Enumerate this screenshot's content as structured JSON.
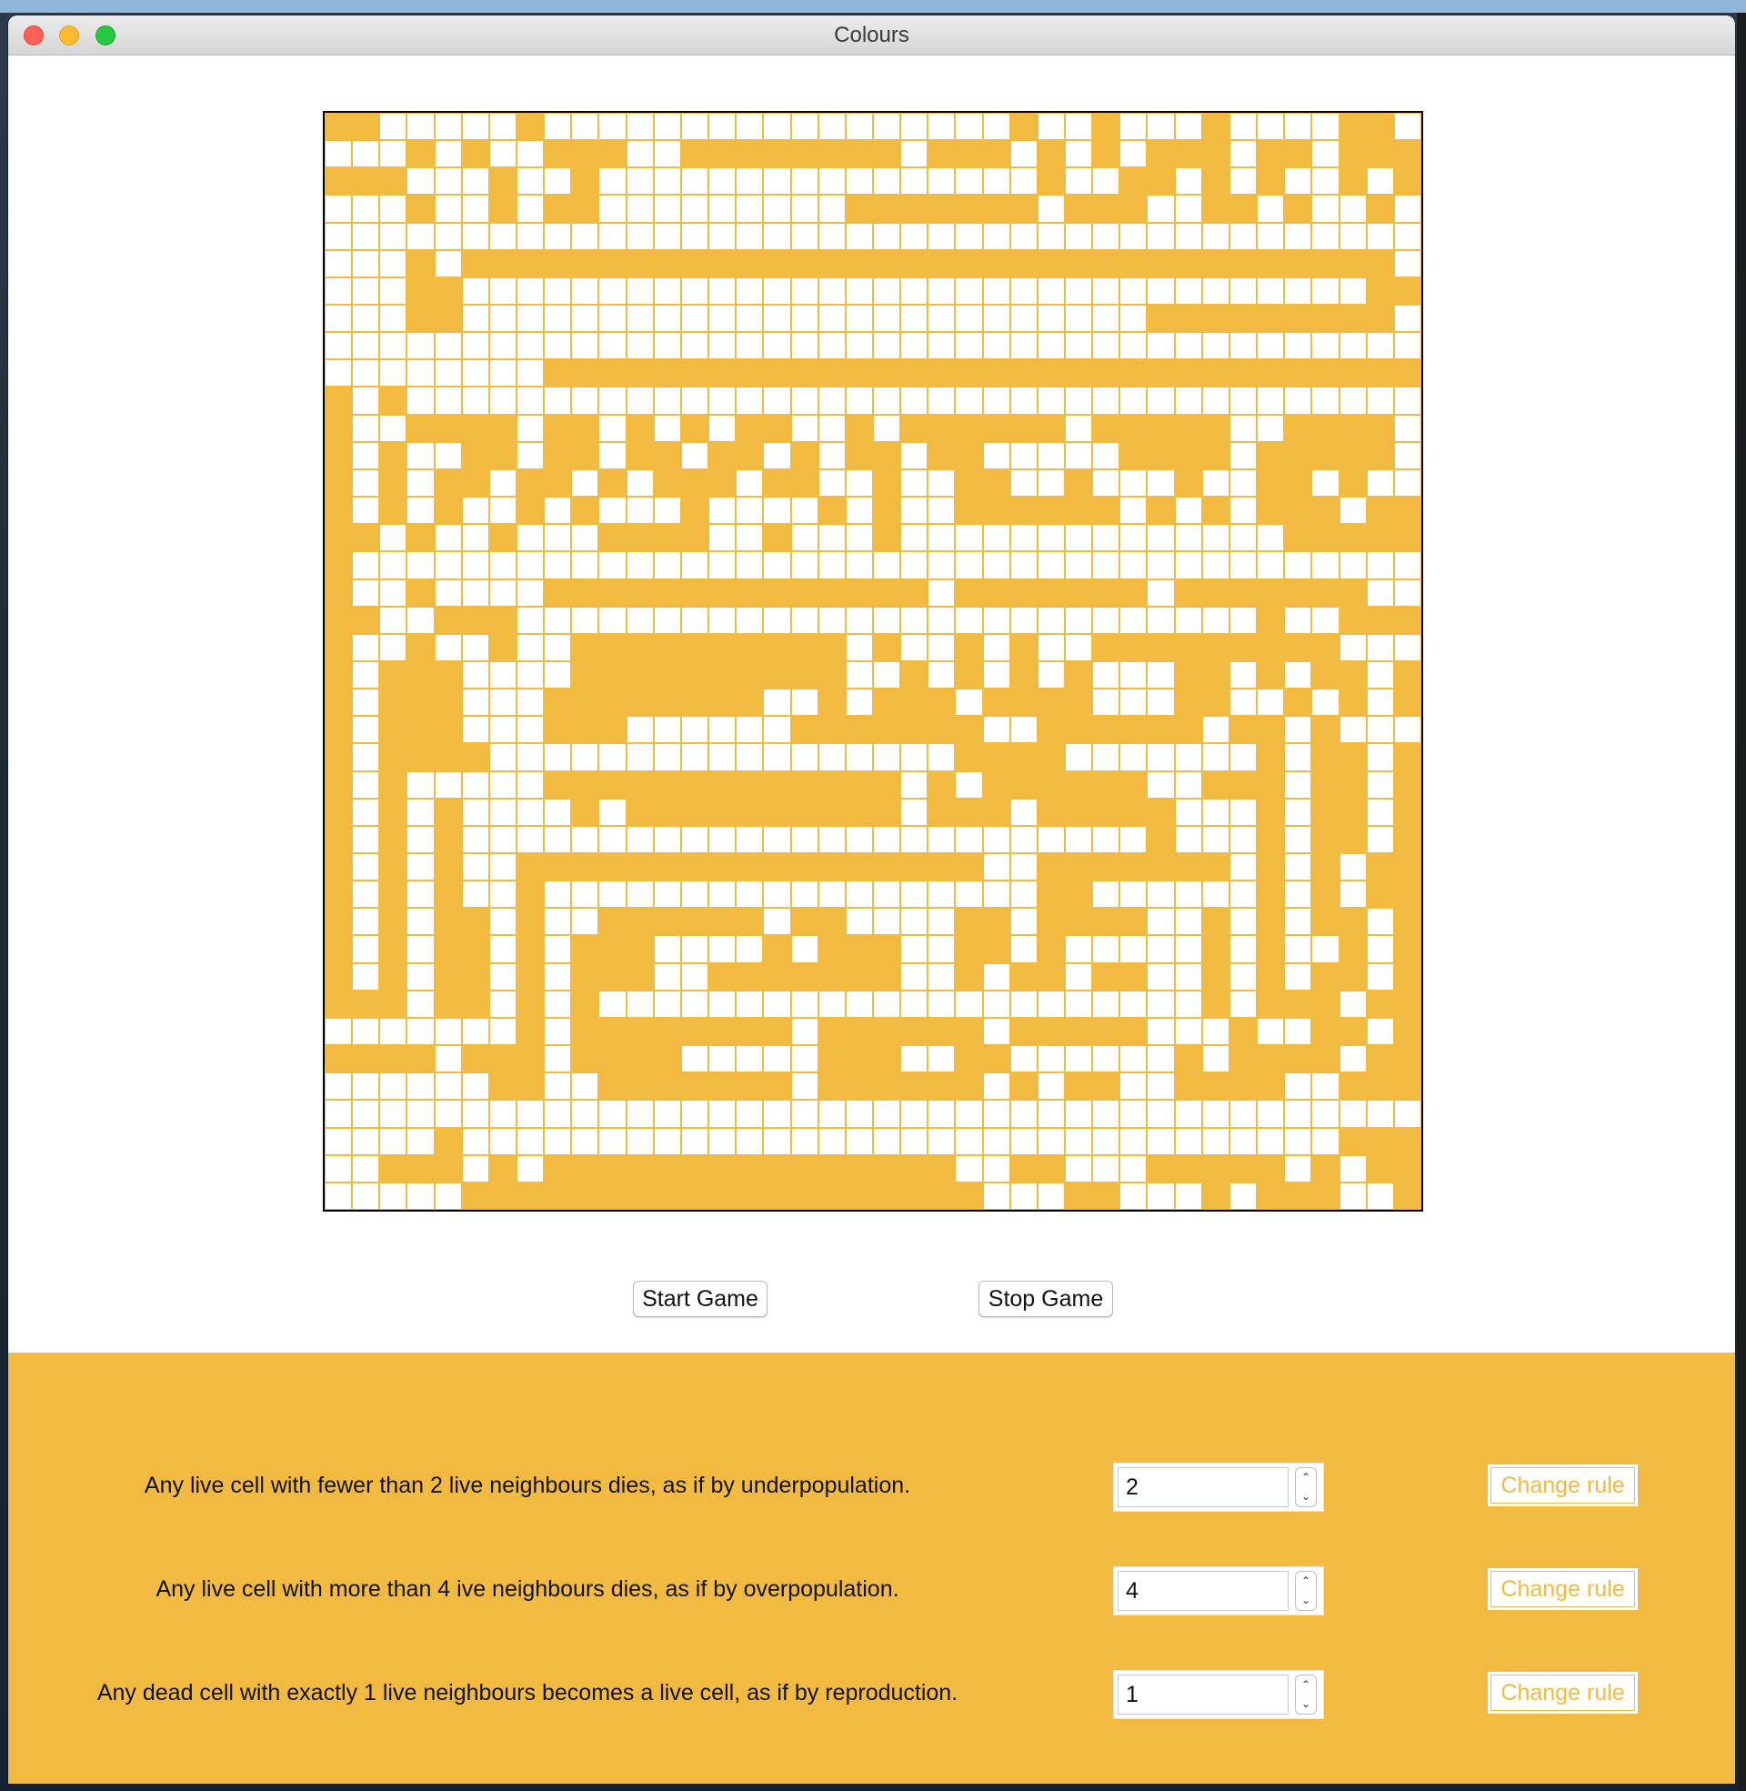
{
  "window": {
    "title": "Colours"
  },
  "colors": {
    "accent": "#f2ba41",
    "dead_cell": "#ffffff",
    "grid_line": "#f2ba41",
    "board_border": "#000000"
  },
  "board": {
    "cols": 40,
    "rows": 40,
    "live_cells": [
      "1100000100000000000000000100100010000110",
      "0001010011100111111110111010101110110111",
      "1110001001000000000000000010011010100101",
      "0001001011000000000111111101110011010010",
      "0000000000000000000000000000000000000000",
      "0001011111111111111111111111111111111110",
      "0001100000000000000000000000000000000011",
      "0001100000000000000000000000001111111110",
      "0000000000000000000000000000000000000000",
      "0000000011111111111111111111111111111111",
      "1010000000000000000000000000000000000000",
      "1001111011010101100101111110111110011110",
      "1010011011011011010110110000011110111110",
      "1010110110101110110010011001000100110100",
      "1010100101000100001010011111101010111011",
      "1101001000111100100010000000000000011111",
      "1000000000000000000000000000000000000000",
      "1001000011111111111111011111110111111100",
      "1100111000000000000000000000000000100111",
      "1001001001111111111010010100111111111000",
      "1011100001111111111001010101000110101101",
      "1011100011111111001011101111000110010101",
      "1011100011100000011111110011111101101000",
      "1011110000000000000000011110000000101101",
      "1010000011111111111110101111110011101101",
      "1010100001011111111110111011111000101101",
      "1010100000000000000000000000001000101101",
      "1010100111111111111111110011111110101011",
      "1010100100000000000000000011000000101011",
      "1010110100111111011000011011110010101101",
      "1010110101110000101110011010000010100101",
      "1010110101110011111110010110110010101101",
      "1110110101000000000000000000000010111011",
      "0000000101111111101111110111110001001101",
      "1111011101111000001110011000000101111011",
      "0000001100111111101111110101100111100111",
      "0000000000000000000000000000000000000000",
      "0000100000000000000000000000000000000111",
      "0011101011111111111111100110001111101011",
      "0000011111111111111111110001100010111001"
    ]
  },
  "controls": {
    "start_label": "Start Game",
    "stop_label": "Stop Game"
  },
  "rules": [
    {
      "text": "Any live cell with fewer than 2 live neighbours dies, as if by underpopulation.",
      "value": "2",
      "button": "Change rule"
    },
    {
      "text": "Any live cell with more than 4 ive neighbours dies, as if by overpopulation.",
      "value": "4",
      "button": "Change rule"
    },
    {
      "text": "Any dead cell with exactly 1 live neighbours becomes a live cell, as if by reproduction.",
      "value": "1",
      "button": "Change rule"
    }
  ],
  "icons": {
    "stepper_up": "chevron-up-icon",
    "stepper_down": "chevron-down-icon"
  }
}
